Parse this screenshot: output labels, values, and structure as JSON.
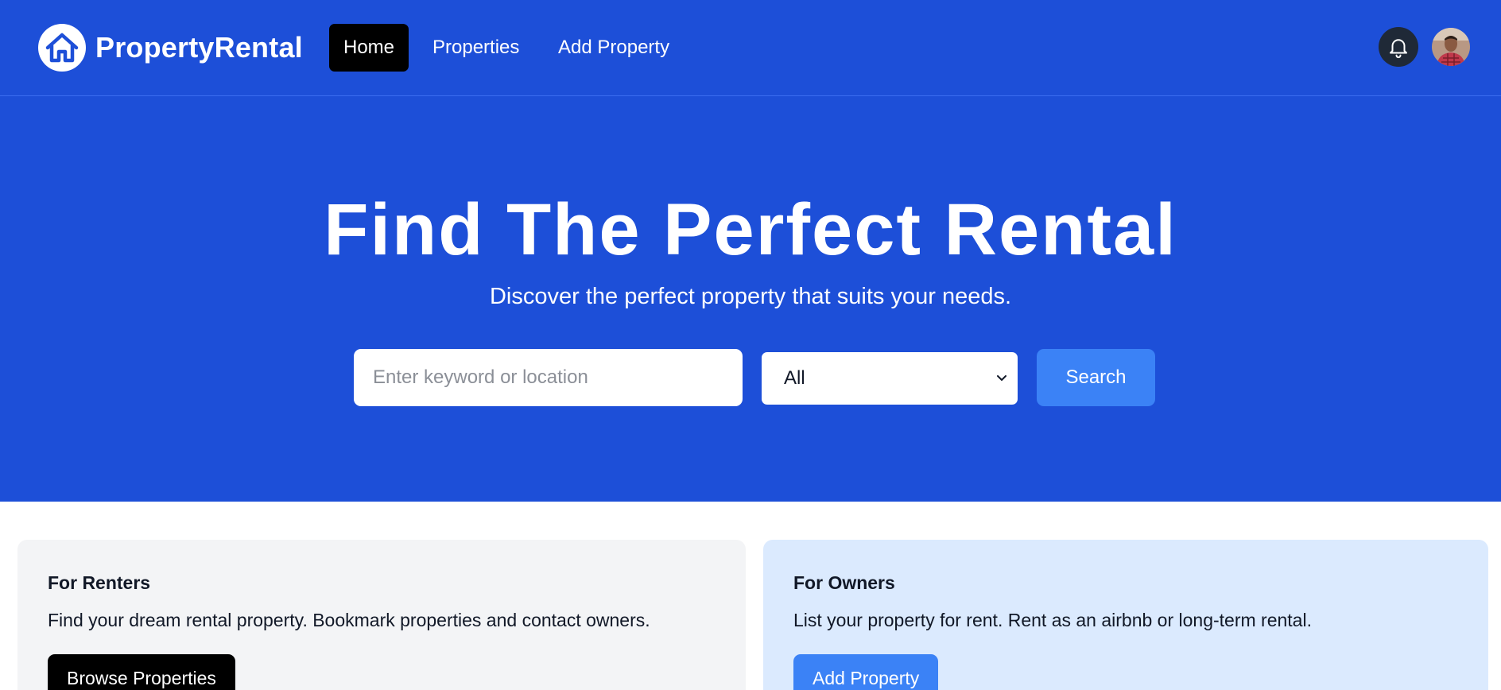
{
  "brand": {
    "name": "PropertyRental",
    "logo_icon": "house-icon"
  },
  "nav": {
    "links": [
      {
        "label": "Home",
        "active": true
      },
      {
        "label": "Properties",
        "active": false
      },
      {
        "label": "Add Property",
        "active": false
      }
    ],
    "notification_icon": "bell-icon",
    "avatar": "user-avatar"
  },
  "hero": {
    "title": "Find The Perfect Rental",
    "subtitle": "Discover the perfect property that suits your needs.",
    "search": {
      "placeholder": "Enter keyword or location",
      "value": "",
      "type_selected": "All",
      "button_label": "Search"
    }
  },
  "cards": {
    "renters": {
      "title": "For Renters",
      "text": "Find your dream rental property. Bookmark properties and contact owners.",
      "button_label": "Browse Properties"
    },
    "owners": {
      "title": "For Owners",
      "text": "List your property for rent. Rent as an airbnb or long-term rental.",
      "button_label": "Add Property"
    }
  },
  "colors": {
    "primary": "#1d4fd8",
    "accent": "#3b82f6",
    "renters_card_bg": "#f3f4f6",
    "owners_card_bg": "#dbeafe"
  }
}
